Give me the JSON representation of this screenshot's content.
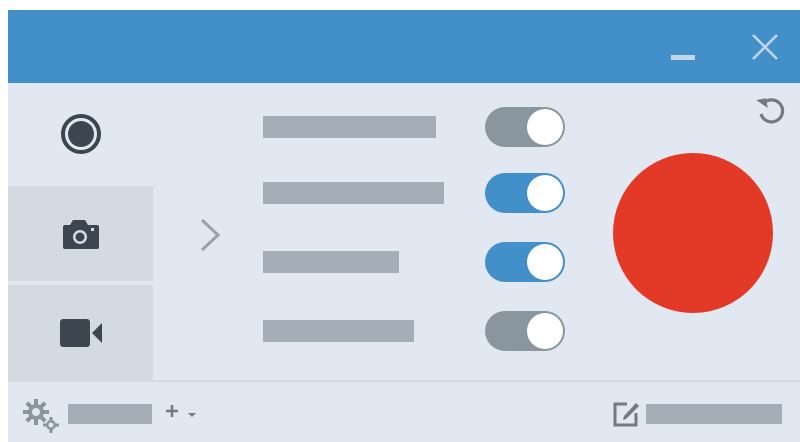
{
  "window": {
    "icons": {
      "minimize": "minimize-icon",
      "close": "close-icon"
    },
    "colors": {
      "titlebar": "#428fca",
      "background": "#e1e8f1"
    }
  },
  "sidebar": {
    "items": [
      {
        "id": "record",
        "icon": "record-icon",
        "selected": true
      },
      {
        "id": "photo",
        "icon": "camera-icon",
        "selected": false
      },
      {
        "id": "video",
        "icon": "video-camera-icon",
        "selected": false
      }
    ]
  },
  "options": [
    {
      "enabled": false
    },
    {
      "enabled": true
    },
    {
      "enabled": true
    },
    {
      "enabled": false
    }
  ],
  "actions": {
    "reset_icon": "reset-icon",
    "record_button_color": "#e23a27",
    "toggle_on_color": "#428fca",
    "toggle_off_color": "#8a969f"
  },
  "footer": {
    "settings_icon": "gear-icon",
    "add_icon": "plus-icon",
    "edit_icon": "edit-icon"
  }
}
